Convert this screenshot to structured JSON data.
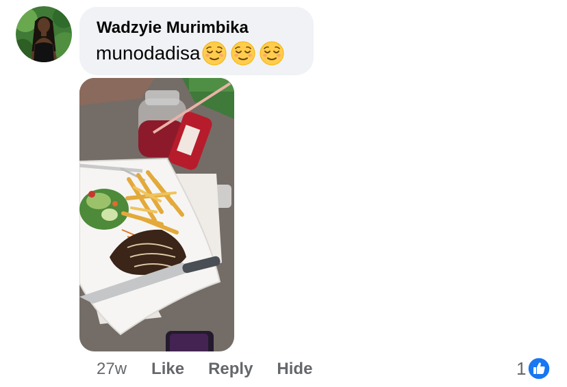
{
  "comment": {
    "author": "Wadzyie Murimbika",
    "text": "munodadisa",
    "emojis": [
      "relieved-face-emoji",
      "relieved-face-emoji",
      "relieved-face-emoji"
    ]
  },
  "attachment": {
    "type": "photo",
    "subject": "plate of steak, fries and salad with a drink jar"
  },
  "meta": {
    "time": "27w"
  },
  "actions": {
    "like_label": "Like",
    "reply_label": "Reply",
    "hide_label": "Hide"
  },
  "reactions": {
    "count": "1",
    "icon": "like-thumb-icon"
  },
  "colors": {
    "bubble_bg": "#f0f2f5",
    "text_primary": "#050505",
    "text_secondary": "#65676b",
    "like_blue": "#1877f2"
  }
}
